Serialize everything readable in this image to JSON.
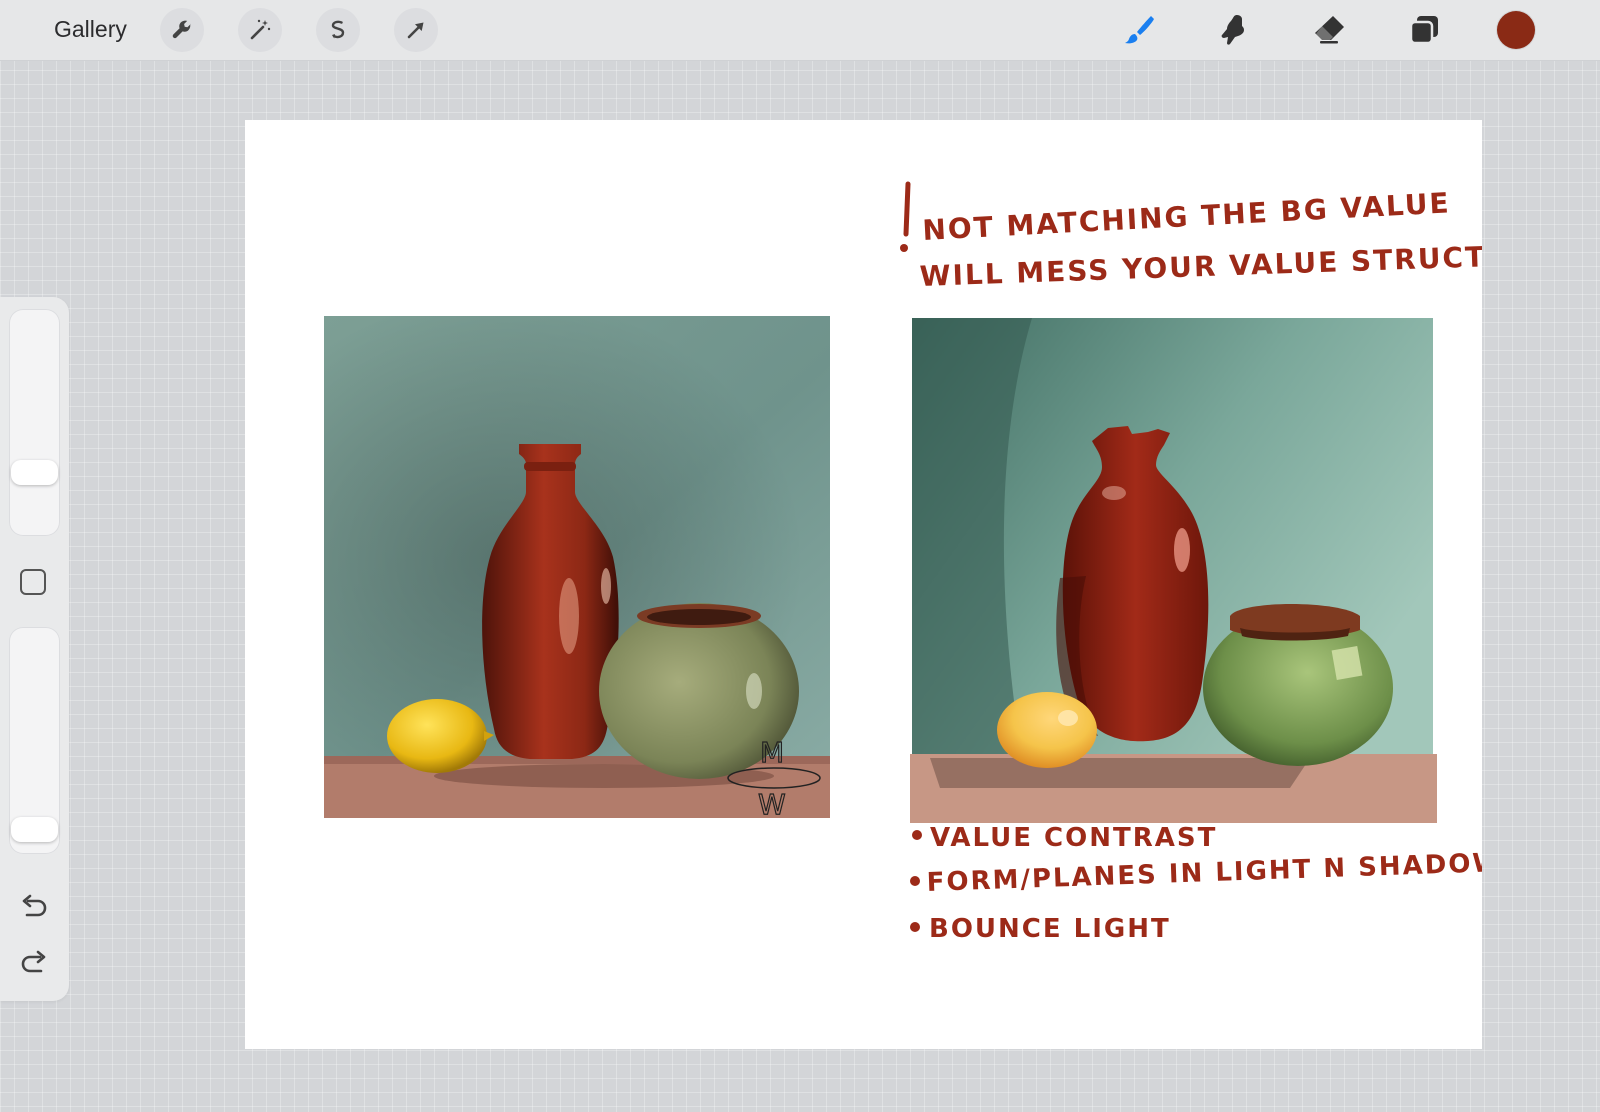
{
  "toolbar": {
    "gallery_label": "Gallery",
    "left_tools": [
      "wrench-icon",
      "magic-wand-icon",
      "selection-icon",
      "transform-arrow-icon"
    ],
    "right_tools": [
      "brush-icon",
      "smudge-icon",
      "eraser-icon",
      "layers-icon"
    ],
    "current_color": "#8a2a15",
    "active_tool_color": "#1a7ff0"
  },
  "sidebar": {
    "brush_size_level": 0.25,
    "opacity_level": 0.05
  },
  "canvas": {
    "note_top_line1": "NOT MATCHING THE BG VALUE",
    "note_top_line2": "WILL MESS YOUR VALUE STRUCTURE",
    "bullets": [
      "VALUE CONTRAST",
      "FORM/PLANES IN LIGHT N SHADOW",
      "BOUNCE LIGHT"
    ],
    "signature": "MW",
    "ink_color": "#9c2a18"
  }
}
